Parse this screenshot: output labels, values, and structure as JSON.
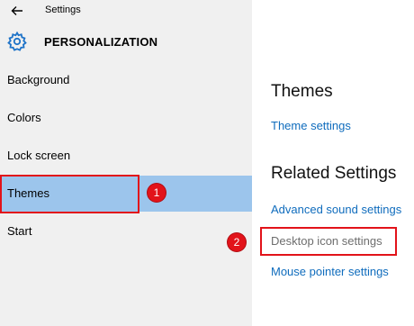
{
  "header": {
    "window_title": "Settings",
    "section_title": "PERSONALIZATION"
  },
  "sidebar": {
    "items": [
      {
        "label": "Background"
      },
      {
        "label": "Colors"
      },
      {
        "label": "Lock screen"
      },
      {
        "label": "Themes",
        "selected": true
      },
      {
        "label": "Start"
      }
    ]
  },
  "main": {
    "themes_heading": "Themes",
    "theme_settings_link": "Theme settings",
    "related_heading": "Related Settings",
    "links": [
      {
        "label": "Advanced sound settings"
      },
      {
        "label": "Desktop icon settings"
      },
      {
        "label": "Mouse pointer settings"
      }
    ]
  },
  "annotations": {
    "badge_1": "1",
    "badge_2": "2"
  },
  "colors": {
    "accent": "#0f6cbd",
    "selection": "#9cc5ec",
    "annotation_red": "#e2131a",
    "sidebar_bg": "#f0f0f0"
  },
  "icons": [
    "back-arrow-icon",
    "gear-icon"
  ]
}
